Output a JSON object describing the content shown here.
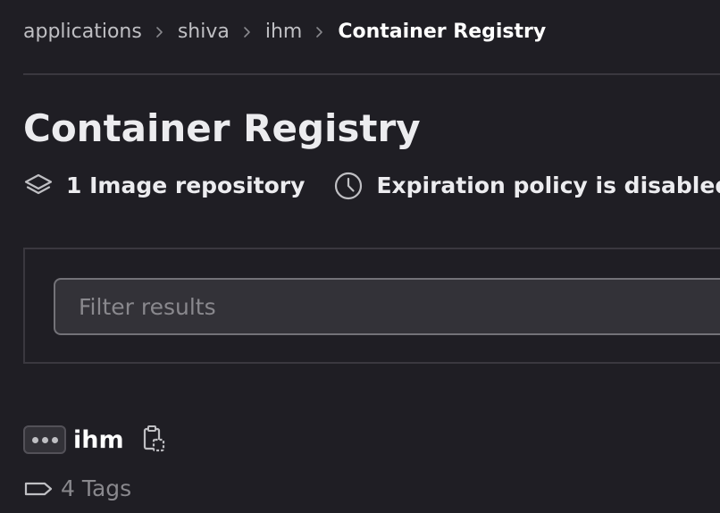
{
  "breadcrumb": {
    "items": [
      "applications",
      "shiva",
      "ihm"
    ],
    "current": "Container Registry",
    "separator_icon": "chevron-right-icon"
  },
  "header": {
    "title": "Container Registry"
  },
  "meta": {
    "repositories": {
      "icon": "layers-icon",
      "text": "1 Image repository"
    },
    "expiration": {
      "icon": "clock-icon",
      "text": "Expiration policy is disabled."
    }
  },
  "filter": {
    "placeholder": "Filter results",
    "value": ""
  },
  "repository": {
    "name": "ihm",
    "more_icon": "ellipsis-icon",
    "copy_icon": "copy-to-clipboard-icon",
    "tags_icon": "label-icon",
    "tags_text": "4 Tags"
  },
  "colors": {
    "background": "#1f1e24",
    "text": "#ececef",
    "muted": "#89888d",
    "border": "#3a383f",
    "input_background": "#333238"
  }
}
